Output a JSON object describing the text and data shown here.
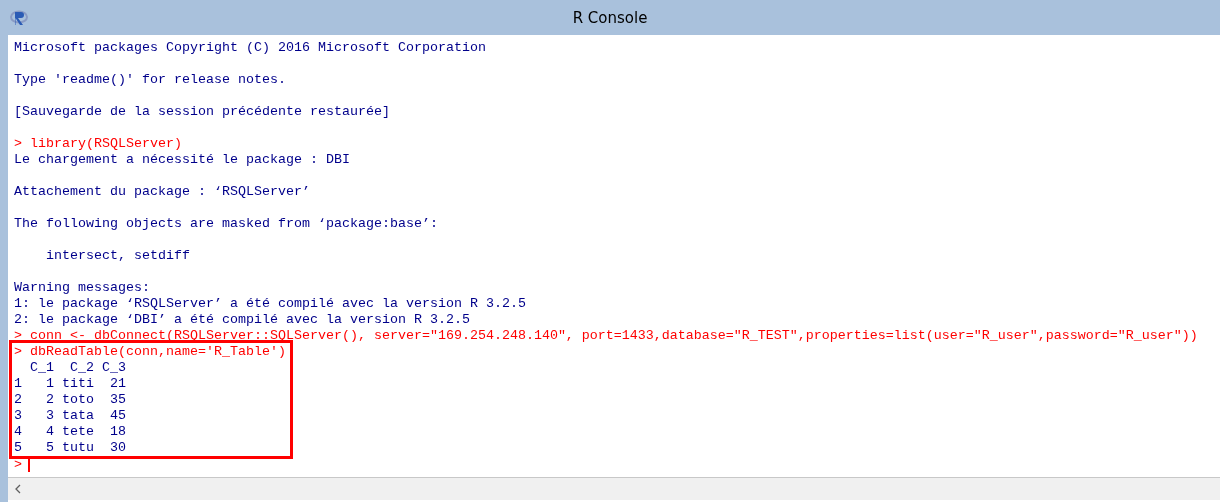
{
  "window": {
    "title": "R Console"
  },
  "console": {
    "lines": [
      {
        "kind": "output",
        "text": "Microsoft packages Copyright (C) 2016 Microsoft Corporation"
      },
      {
        "kind": "blank"
      },
      {
        "kind": "output",
        "text": "Type 'readme()' for release notes."
      },
      {
        "kind": "blank"
      },
      {
        "kind": "output",
        "text": "[Sauvegarde de la session précédente restaurée]"
      },
      {
        "kind": "blank"
      },
      {
        "kind": "input",
        "text": "> library(RSQLServer)"
      },
      {
        "kind": "output",
        "text": "Le chargement a nécessité le package : DBI"
      },
      {
        "kind": "blank"
      },
      {
        "kind": "output",
        "text": "Attachement du package : ‘RSQLServer’"
      },
      {
        "kind": "blank"
      },
      {
        "kind": "output",
        "text": "The following objects are masked from ‘package:base’:"
      },
      {
        "kind": "blank"
      },
      {
        "kind": "output",
        "text": "    intersect, setdiff"
      },
      {
        "kind": "blank"
      },
      {
        "kind": "output",
        "text": "Warning messages:"
      },
      {
        "kind": "output",
        "text": "1: le package ‘RSQLServer’ a été compilé avec la version R 3.2.5"
      },
      {
        "kind": "output",
        "text": "2: le package ‘DBI’ a été compilé avec la version R 3.2.5"
      },
      {
        "kind": "input",
        "text": "> conn <- dbConnect(RSQLServer::SQLServer(), server=\"169.254.248.140\", port=1433,database=\"R_TEST\",properties=list(user=\"R_user\",password=\"R_user\"))"
      }
    ],
    "highlight": [
      {
        "kind": "input",
        "text": "> dbReadTable(conn,name='R_Table')"
      },
      {
        "kind": "output",
        "text": "  C_1  C_2 C_3"
      },
      {
        "kind": "output",
        "text": "1   1 titi  21"
      },
      {
        "kind": "output",
        "text": "2   2 toto  35"
      },
      {
        "kind": "output",
        "text": "3   3 tata  45"
      },
      {
        "kind": "output",
        "text": "4   4 tete  18"
      },
      {
        "kind": "output",
        "text": "5   5 tutu  30"
      }
    ],
    "prompt": ">"
  }
}
